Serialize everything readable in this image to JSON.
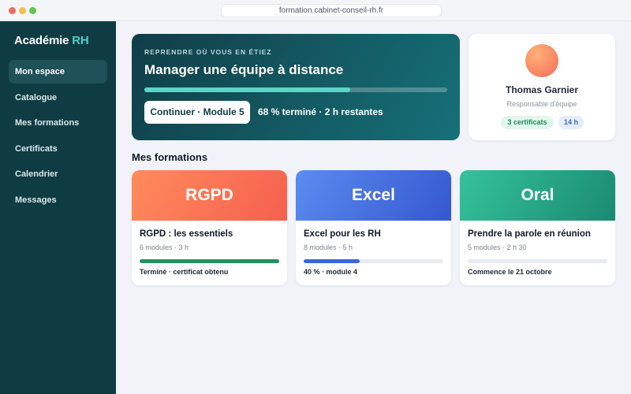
{
  "browser": {
    "url": "formation.cabinet-conseil-rh.fr",
    "dot_colors": [
      "#ed6a5e",
      "#f5bf4f",
      "#61c554"
    ]
  },
  "sidebar": {
    "brand_main": "Académie",
    "brand_accent": "RH",
    "items": [
      {
        "label": "Mon espace",
        "active": true
      },
      {
        "label": "Catalogue",
        "active": false
      },
      {
        "label": "Mes formations",
        "active": false
      },
      {
        "label": "Certificats",
        "active": false
      },
      {
        "label": "Calendrier",
        "active": false
      },
      {
        "label": "Messages",
        "active": false
      }
    ]
  },
  "hero": {
    "eyebrow": "REPRENDRE OÙ VOUS EN ÉTIEZ",
    "title": "Manager une équipe à distance",
    "progress": 0.68,
    "button_label": "Continuer · Module 5",
    "status": "68 % terminé · 2 h restantes"
  },
  "profile": {
    "name": "Thomas Garnier",
    "role": "Responsable d'équipe",
    "badges": [
      "3 certificats",
      "14 h"
    ]
  },
  "section_title": "Mes formations",
  "courses": [
    {
      "banner": "RGPD",
      "title": "RGPD : les essentiels",
      "meta": "6 modules · 3 h",
      "progress": 1.0,
      "status": "Terminé · certificat obtenu",
      "gradient": [
        "#ff8b5c",
        "#f5604f"
      ],
      "bar_color": "#23915e"
    },
    {
      "banner": "Excel",
      "title": "Excel pour les RH",
      "meta": "8 modules · 5 h",
      "progress": 0.4,
      "status": "40 % · module 4",
      "gradient": [
        "#5b8cf0",
        "#3557cf"
      ],
      "bar_color": "#3a66d6"
    },
    {
      "banner": "Oral",
      "title": "Prendre la parole en réunion",
      "meta": "5 modules · 2 h 30",
      "progress": 0.0,
      "status": "Commence le 21 octobre",
      "gradient": [
        "#35c39a",
        "#1a8a72"
      ],
      "bar_color": "#23915e"
    }
  ]
}
